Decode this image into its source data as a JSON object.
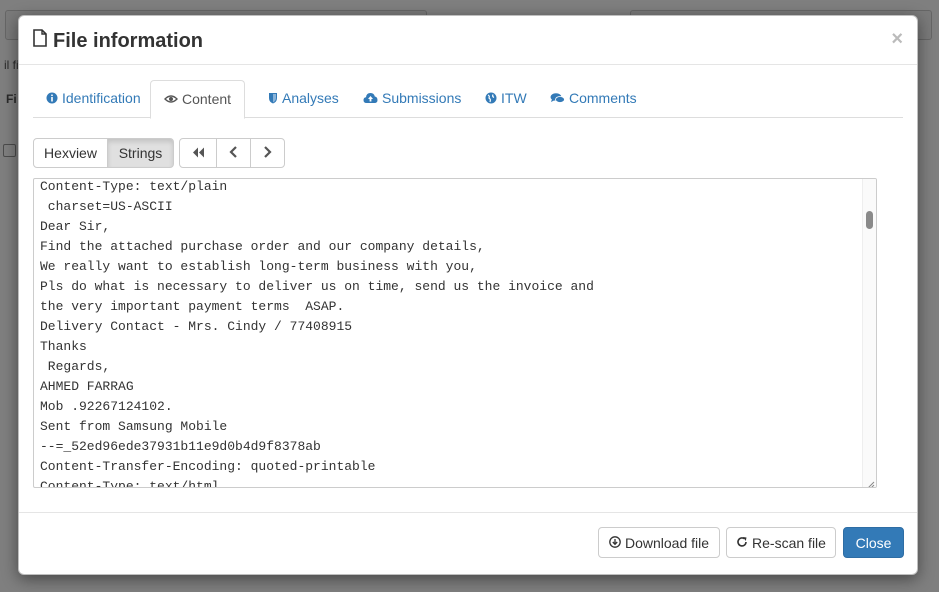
{
  "modal": {
    "title": "File information",
    "close_symbol": "×",
    "title_icon": "file-icon"
  },
  "tabs": [
    {
      "label": "Identification",
      "icon": "info-circle-icon",
      "active": false
    },
    {
      "label": "Content",
      "icon": "eye-icon",
      "active": true
    },
    {
      "label": "Analyses",
      "icon": "shield-icon",
      "active": false
    },
    {
      "label": "Submissions",
      "icon": "cloud-upload-icon",
      "active": false
    },
    {
      "label": "ITW",
      "icon": "globe-icon",
      "active": false
    },
    {
      "label": "Comments",
      "icon": "comments-icon",
      "active": false
    }
  ],
  "view_toggle": {
    "hexview_label": "Hexview",
    "strings_label": "Strings",
    "selected": "Strings"
  },
  "nav_buttons": [
    "first-page-icon",
    "previous-page-icon",
    "next-page-icon"
  ],
  "strings_lines": [
    "Content-Type: text/plain",
    " charset=US-ASCII",
    "Dear Sir,",
    "Find the attached purchase order and our company details,",
    "We really want to establish long-term business with you,",
    "Pls do what is necessary to deliver us on time, send us the invoice and",
    "the very important payment terms  ASAP.",
    "Delivery Contact - Mrs. Cindy / 77408915",
    "Thanks",
    " Regards,",
    "AHMED FARRAG",
    "Mob .92267124102.",
    "Sent from Samsung Mobile",
    "--=_52ed96ede37931b11e9d0b4d9f8378ab",
    "Content-Transfer-Encoding: quoted-printable",
    "Content-Type: text/html"
  ],
  "footer": {
    "download_label": "Download file",
    "rescan_label": "Re-scan file",
    "close_label": "Close"
  },
  "colors": {
    "accent": "#337ab7",
    "link": "#337ab7",
    "overlay": "#6b6b6b"
  }
}
